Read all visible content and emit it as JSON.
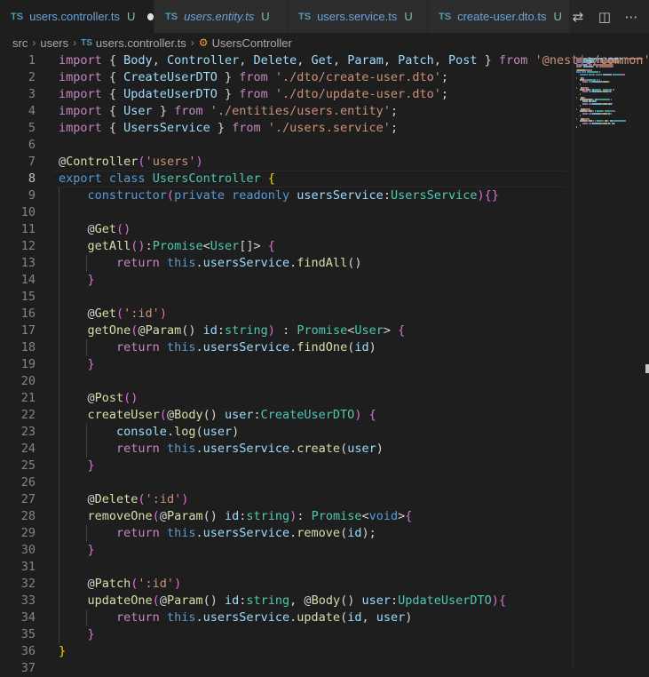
{
  "tabs": [
    {
      "label": "users.controller.ts",
      "status": "U",
      "active": true,
      "italic": false,
      "dirty": true
    },
    {
      "label": "users.entity.ts",
      "status": "U",
      "active": false,
      "italic": true,
      "dirty": false
    },
    {
      "label": "users.service.ts",
      "status": "U",
      "active": false,
      "italic": false,
      "dirty": false
    },
    {
      "label": "create-user.dto.ts",
      "status": "U",
      "active": false,
      "italic": false,
      "dirty": false
    }
  ],
  "tab_file_type": "TS",
  "actions": [
    {
      "name": "open-changes-icon",
      "glyph": "⇄"
    },
    {
      "name": "split-editor-icon",
      "glyph": "◫"
    },
    {
      "name": "more-actions-icon",
      "glyph": "⋯"
    }
  ],
  "breadcrumb": {
    "items": [
      "src",
      "users"
    ],
    "file_type": "TS",
    "file": "users.controller.ts",
    "symbol": "UsersController"
  },
  "editor": {
    "current_line": 8,
    "lines": [
      {
        "n": "1",
        "tokens": [
          [
            "c",
            "import"
          ],
          [
            "p",
            " { "
          ],
          [
            "v",
            "Body"
          ],
          [
            "p",
            ", "
          ],
          [
            "v",
            "Controller"
          ],
          [
            "p",
            ", "
          ],
          [
            "v",
            "Delete"
          ],
          [
            "p",
            ", "
          ],
          [
            "v",
            "Get"
          ],
          [
            "p",
            ", "
          ],
          [
            "v",
            "Param"
          ],
          [
            "p",
            ", "
          ],
          [
            "v",
            "Patch"
          ],
          [
            "p",
            ", "
          ],
          [
            "v",
            "Post"
          ],
          [
            "p",
            " } "
          ],
          [
            "c",
            "from"
          ],
          [
            "p",
            " "
          ],
          [
            "s",
            "'@nestjs/common'"
          ],
          [
            "p",
            ";"
          ]
        ]
      },
      {
        "n": "2",
        "tokens": [
          [
            "c",
            "import"
          ],
          [
            "p",
            " { "
          ],
          [
            "v",
            "CreateUserDTO"
          ],
          [
            "p",
            " } "
          ],
          [
            "c",
            "from"
          ],
          [
            "p",
            " "
          ],
          [
            "s",
            "'./dto/create-user.dto'"
          ],
          [
            "p",
            ";"
          ]
        ]
      },
      {
        "n": "3",
        "tokens": [
          [
            "c",
            "import"
          ],
          [
            "p",
            " { "
          ],
          [
            "v",
            "UpdateUserDTO"
          ],
          [
            "p",
            " } "
          ],
          [
            "c",
            "from"
          ],
          [
            "p",
            " "
          ],
          [
            "s",
            "'./dto/update-user.dto'"
          ],
          [
            "p",
            ";"
          ]
        ]
      },
      {
        "n": "4",
        "tokens": [
          [
            "c",
            "import"
          ],
          [
            "p",
            " { "
          ],
          [
            "v",
            "User"
          ],
          [
            "p",
            " } "
          ],
          [
            "c",
            "from"
          ],
          [
            "p",
            " "
          ],
          [
            "s",
            "'./entities/users.entity'"
          ],
          [
            "p",
            ";"
          ]
        ]
      },
      {
        "n": "5",
        "tokens": [
          [
            "c",
            "import"
          ],
          [
            "p",
            " { "
          ],
          [
            "v",
            "UsersService"
          ],
          [
            "p",
            " } "
          ],
          [
            "c",
            "from"
          ],
          [
            "p",
            " "
          ],
          [
            "s",
            "'./users.service'"
          ],
          [
            "p",
            ";"
          ]
        ]
      },
      {
        "n": "6",
        "tokens": []
      },
      {
        "n": "7",
        "tokens": [
          [
            "p",
            "@"
          ],
          [
            "f",
            "Controller"
          ],
          [
            "b2",
            "("
          ],
          [
            "s",
            "'users'"
          ],
          [
            "b2",
            ")"
          ]
        ]
      },
      {
        "n": "8",
        "tokens": [
          [
            "k",
            "export"
          ],
          [
            "p",
            " "
          ],
          [
            "k",
            "class"
          ],
          [
            "p",
            " "
          ],
          [
            "t",
            "UsersController"
          ],
          [
            "p",
            " "
          ],
          [
            "b",
            "{"
          ]
        ]
      },
      {
        "n": "9",
        "tokens": [
          [
            "p",
            "    "
          ],
          [
            "k",
            "constructor"
          ],
          [
            "b2",
            "("
          ],
          [
            "k",
            "private"
          ],
          [
            "p",
            " "
          ],
          [
            "k",
            "readonly"
          ],
          [
            "p",
            " "
          ],
          [
            "v",
            "usersService"
          ],
          [
            "p",
            ":"
          ],
          [
            "t",
            "UsersService"
          ],
          [
            "b2",
            ")"
          ],
          [
            "b2",
            "{}"
          ]
        ]
      },
      {
        "n": "10",
        "tokens": []
      },
      {
        "n": "11",
        "tokens": [
          [
            "p",
            "    @"
          ],
          [
            "f",
            "Get"
          ],
          [
            "b2",
            "()"
          ]
        ]
      },
      {
        "n": "12",
        "tokens": [
          [
            "p",
            "    "
          ],
          [
            "f",
            "getAll"
          ],
          [
            "b2",
            "()"
          ],
          [
            "p",
            ":"
          ],
          [
            "t",
            "Promise"
          ],
          [
            "p",
            "<"
          ],
          [
            "t",
            "User"
          ],
          [
            "p",
            "[]> "
          ],
          [
            "b2",
            "{"
          ]
        ]
      },
      {
        "n": "13",
        "tokens": [
          [
            "p",
            "        "
          ],
          [
            "c",
            "return"
          ],
          [
            "p",
            " "
          ],
          [
            "k",
            "this"
          ],
          [
            "p",
            "."
          ],
          [
            "v",
            "usersService"
          ],
          [
            "p",
            "."
          ],
          [
            "f",
            "findAll"
          ],
          [
            "p",
            "()"
          ]
        ]
      },
      {
        "n": "14",
        "tokens": [
          [
            "p",
            "    "
          ],
          [
            "b2",
            "}"
          ]
        ]
      },
      {
        "n": "15",
        "tokens": []
      },
      {
        "n": "16",
        "tokens": [
          [
            "p",
            "    @"
          ],
          [
            "f",
            "Get"
          ],
          [
            "b2",
            "("
          ],
          [
            "s",
            "':id'"
          ],
          [
            "b2",
            ")"
          ]
        ]
      },
      {
        "n": "17",
        "tokens": [
          [
            "p",
            "    "
          ],
          [
            "f",
            "getOne"
          ],
          [
            "b2",
            "("
          ],
          [
            "p",
            "@"
          ],
          [
            "f",
            "Param"
          ],
          [
            "p",
            "() "
          ],
          [
            "v",
            "id"
          ],
          [
            "p",
            ":"
          ],
          [
            "t",
            "string"
          ],
          [
            "b2",
            ")"
          ],
          [
            "p",
            " : "
          ],
          [
            "t",
            "Promise"
          ],
          [
            "p",
            "<"
          ],
          [
            "t",
            "User"
          ],
          [
            "p",
            "> "
          ],
          [
            "b2",
            "{"
          ]
        ]
      },
      {
        "n": "18",
        "tokens": [
          [
            "p",
            "        "
          ],
          [
            "c",
            "return"
          ],
          [
            "p",
            " "
          ],
          [
            "k",
            "this"
          ],
          [
            "p",
            "."
          ],
          [
            "v",
            "usersService"
          ],
          [
            "p",
            "."
          ],
          [
            "f",
            "findOne"
          ],
          [
            "p",
            "("
          ],
          [
            "v",
            "id"
          ],
          [
            "p",
            ")"
          ]
        ]
      },
      {
        "n": "19",
        "tokens": [
          [
            "p",
            "    "
          ],
          [
            "b2",
            "}"
          ]
        ]
      },
      {
        "n": "20",
        "tokens": []
      },
      {
        "n": "21",
        "tokens": [
          [
            "p",
            "    @"
          ],
          [
            "f",
            "Post"
          ],
          [
            "b2",
            "()"
          ]
        ]
      },
      {
        "n": "22",
        "tokens": [
          [
            "p",
            "    "
          ],
          [
            "f",
            "createUser"
          ],
          [
            "b2",
            "("
          ],
          [
            "p",
            "@"
          ],
          [
            "f",
            "Body"
          ],
          [
            "p",
            "() "
          ],
          [
            "v",
            "user"
          ],
          [
            "p",
            ":"
          ],
          [
            "t",
            "CreateUserDTO"
          ],
          [
            "b2",
            ")"
          ],
          [
            "p",
            " "
          ],
          [
            "b2",
            "{"
          ]
        ]
      },
      {
        "n": "23",
        "tokens": [
          [
            "p",
            "        "
          ],
          [
            "v",
            "console"
          ],
          [
            "p",
            "."
          ],
          [
            "f",
            "log"
          ],
          [
            "p",
            "("
          ],
          [
            "v",
            "user"
          ],
          [
            "p",
            ")"
          ]
        ]
      },
      {
        "n": "24",
        "tokens": [
          [
            "p",
            "        "
          ],
          [
            "c",
            "return"
          ],
          [
            "p",
            " "
          ],
          [
            "k",
            "this"
          ],
          [
            "p",
            "."
          ],
          [
            "v",
            "usersService"
          ],
          [
            "p",
            "."
          ],
          [
            "f",
            "create"
          ],
          [
            "p",
            "("
          ],
          [
            "v",
            "user"
          ],
          [
            "p",
            ")"
          ]
        ]
      },
      {
        "n": "25",
        "tokens": [
          [
            "p",
            "    "
          ],
          [
            "b2",
            "}"
          ]
        ]
      },
      {
        "n": "26",
        "tokens": []
      },
      {
        "n": "27",
        "tokens": [
          [
            "p",
            "    @"
          ],
          [
            "f",
            "Delete"
          ],
          [
            "b2",
            "("
          ],
          [
            "s",
            "':id'"
          ],
          [
            "b2",
            ")"
          ]
        ]
      },
      {
        "n": "28",
        "tokens": [
          [
            "p",
            "    "
          ],
          [
            "f",
            "removeOne"
          ],
          [
            "b2",
            "("
          ],
          [
            "p",
            "@"
          ],
          [
            "f",
            "Param"
          ],
          [
            "p",
            "() "
          ],
          [
            "v",
            "id"
          ],
          [
            "p",
            ":"
          ],
          [
            "t",
            "string"
          ],
          [
            "b2",
            ")"
          ],
          [
            "p",
            ": "
          ],
          [
            "t",
            "Promise"
          ],
          [
            "p",
            "<"
          ],
          [
            "k",
            "void"
          ],
          [
            "p",
            ">"
          ],
          [
            "b2",
            "{"
          ]
        ]
      },
      {
        "n": "29",
        "tokens": [
          [
            "p",
            "        "
          ],
          [
            "c",
            "return"
          ],
          [
            "p",
            " "
          ],
          [
            "k",
            "this"
          ],
          [
            "p",
            "."
          ],
          [
            "v",
            "usersService"
          ],
          [
            "p",
            "."
          ],
          [
            "f",
            "remove"
          ],
          [
            "p",
            "("
          ],
          [
            "v",
            "id"
          ],
          [
            "p",
            ");"
          ]
        ]
      },
      {
        "n": "30",
        "tokens": [
          [
            "p",
            "    "
          ],
          [
            "b2",
            "}"
          ]
        ]
      },
      {
        "n": "31",
        "tokens": []
      },
      {
        "n": "32",
        "tokens": [
          [
            "p",
            "    @"
          ],
          [
            "f",
            "Patch"
          ],
          [
            "b2",
            "("
          ],
          [
            "s",
            "':id'"
          ],
          [
            "b2",
            ")"
          ]
        ]
      },
      {
        "n": "33",
        "tokens": [
          [
            "p",
            "    "
          ],
          [
            "f",
            "updateOne"
          ],
          [
            "b2",
            "("
          ],
          [
            "p",
            "@"
          ],
          [
            "f",
            "Param"
          ],
          [
            "p",
            "() "
          ],
          [
            "v",
            "id"
          ],
          [
            "p",
            ":"
          ],
          [
            "t",
            "string"
          ],
          [
            "p",
            ", @"
          ],
          [
            "f",
            "Body"
          ],
          [
            "p",
            "() "
          ],
          [
            "v",
            "user"
          ],
          [
            "p",
            ":"
          ],
          [
            "t",
            "UpdateUserDTO"
          ],
          [
            "b2",
            ")"
          ],
          [
            "b2",
            "{"
          ]
        ]
      },
      {
        "n": "34",
        "tokens": [
          [
            "p",
            "        "
          ],
          [
            "c",
            "return"
          ],
          [
            "p",
            " "
          ],
          [
            "k",
            "this"
          ],
          [
            "p",
            "."
          ],
          [
            "v",
            "usersService"
          ],
          [
            "p",
            "."
          ],
          [
            "f",
            "update"
          ],
          [
            "p",
            "("
          ],
          [
            "v",
            "id"
          ],
          [
            "p",
            ", "
          ],
          [
            "v",
            "user"
          ],
          [
            "p",
            ")"
          ]
        ]
      },
      {
        "n": "35",
        "tokens": [
          [
            "p",
            "    "
          ],
          [
            "b2",
            "}"
          ]
        ]
      },
      {
        "n": "36",
        "tokens": [
          [
            "b",
            "}"
          ]
        ]
      },
      {
        "n": "37",
        "tokens": []
      }
    ]
  },
  "colors": {
    "background": "#1e1e1e",
    "tab_active_bg": "#1e1e1e",
    "tab_inactive_bg": "#2d2d2d",
    "untracked_status": "#73c991",
    "ts_icon": "#519aba"
  }
}
